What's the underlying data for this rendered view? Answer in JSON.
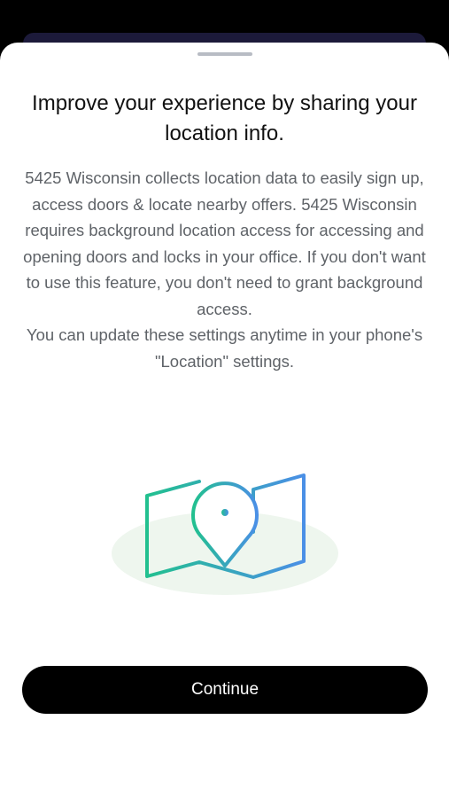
{
  "sheet": {
    "title": "Improve your experience by sharing your location info.",
    "body_paragraphs": [
      "5425 Wisconsin collects location data to easily sign up, access doors & locate nearby offers. 5425 Wisconsin requires background location access for accessing and opening doors and locks in your office. If you don't want to use this feature, you don't need to grant background access.",
      "You can update these settings anytime in your phone's \"Location\" settings."
    ],
    "illustration_icon": "map-location-pin-icon",
    "continue_label": "Continue"
  },
  "colors": {
    "title_text": "#111111",
    "body_text": "#5f6368",
    "button_bg": "#000000",
    "button_text": "#ffffff",
    "illustration_gradient_start": "#22c08f",
    "illustration_gradient_end": "#4a8fe6",
    "illustration_backdrop": "#eef6ee"
  }
}
